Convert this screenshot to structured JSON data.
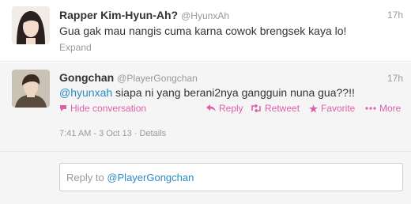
{
  "tweets": [
    {
      "display_name": "Rapper Kim-Hyun-Ah?",
      "handle": "@HyunxAh",
      "time": "17h",
      "text": "Gua gak mau nangis cuma karna cowok brengsek kaya lo!",
      "expand_label": "Expand"
    },
    {
      "display_name": "Gongchan",
      "handle": "@PlayerGongchan",
      "time": "17h",
      "text_mention": "@hyunxah",
      "text_rest": " siapa ni yang berani2nya gangguin nuna gua??!!",
      "actions": {
        "hide": "Hide conversation",
        "reply": "Reply",
        "retweet": "Retweet",
        "favorite": "Favorite",
        "more": "More"
      },
      "timestamp": "7:41 AM - 3 Oct 13",
      "details": "Details",
      "reply_prefix": "Reply to ",
      "reply_mention": "@PlayerGongchan"
    }
  ],
  "colors": {
    "link": "#2a8bc4",
    "action": "#e060a8",
    "muted": "#999999"
  }
}
